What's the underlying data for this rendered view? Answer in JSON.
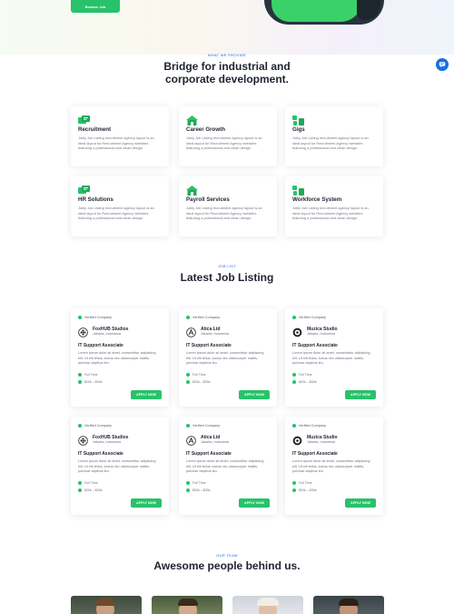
{
  "hero": {
    "button_label": "Browse Job"
  },
  "services": {
    "eyebrow": "WHAT WE PROVIDE",
    "title_line1": "Bridge for industrial and",
    "title_line2": "corporate development.",
    "items": [
      {
        "title": "Recruitment",
        "desc": "Jobly Job Listing recruitment agency layout is an ideal layout for Recruitment Agency websites featuring a professional and clean design.",
        "icon": "recruitment-icon"
      },
      {
        "title": "Career Growth",
        "desc": "Jobly Job Listing recruitment agency layout is an ideal layout for Recruitment Agency websites featuring a professional and clean design.",
        "icon": "career-growth-icon"
      },
      {
        "title": "Gigs",
        "desc": "Jobly Job Listing recruitment agency layout is an ideal layout for Recruitment Agency websites featuring a professional and clean design.",
        "icon": "gigs-icon"
      },
      {
        "title": "HR Solutions",
        "desc": "Jobly Job Listing recruitment agency layout is an ideal layout for Recruitment Agency websites featuring a professional and clean design.",
        "icon": "hr-solutions-icon"
      },
      {
        "title": "Payroll Services",
        "desc": "Jobly Job Listing recruitment agency layout is an ideal layout for Recruitment Agency websites featuring a professional and clean design.",
        "icon": "payroll-icon"
      },
      {
        "title": "Workforce System",
        "desc": "Jobly Job Listing recruitment agency layout is an ideal layout for Recruitment Agency websites featuring a professional and clean design.",
        "icon": "workforce-icon"
      }
    ]
  },
  "jobs": {
    "eyebrow": "JOB LIST",
    "title": "Latest Job Listing",
    "items": [
      {
        "verified": "Verified Company",
        "company": "FoxHUB Studios",
        "location": "Jakarta, Indonesia",
        "role": "IT Support Associate",
        "desc": "Lorem ipsum dolor sit amet, consectetur adipiscing elit. Ut elit tellus, luctus nec ullamcorper mattis, pulvinar dapibus leo.",
        "type": "Full Time",
        "salary": "$20k – $30k",
        "apply": "APPLY NOW",
        "logo": "foxhub-logo"
      },
      {
        "verified": "Verified Company",
        "company": "Atica Ltd",
        "location": "Jakarta, Indonesia",
        "role": "IT Support Associate",
        "desc": "Lorem ipsum dolor sit amet, consectetur adipiscing elit. Ut elit tellus, luctus nec ullamcorper mattis, pulvinar dapibus leo.",
        "type": "Full Time",
        "salary": "$20k – $30k",
        "apply": "APPLY NOW",
        "logo": "atica-logo"
      },
      {
        "verified": "Verified Company",
        "company": "Muzica Studio",
        "location": "Jakarta, Indonesia",
        "role": "IT Support Associate",
        "desc": "Lorem ipsum dolor sit amet, consectetur adipiscing elit. Ut elit tellus, luctus nec ullamcorper mattis, pulvinar dapibus leo.",
        "type": "Full Time",
        "salary": "$20k – $30k",
        "apply": "APPLY NOW",
        "logo": "muzica-logo"
      },
      {
        "verified": "Verified Company",
        "company": "FoxHUB Studios",
        "location": "Jakarta, Indonesia",
        "role": "IT Support Associate",
        "desc": "Lorem ipsum dolor sit amet, consectetur adipiscing elit. Ut elit tellus, luctus nec ullamcorper mattis, pulvinar dapibus leo.",
        "type": "Full Time",
        "salary": "$20k – $30k",
        "apply": "APPLY NOW",
        "logo": "foxhub-logo"
      },
      {
        "verified": "Verified Company",
        "company": "Atica Ltd",
        "location": "Jakarta, Indonesia",
        "role": "IT Support Associate",
        "desc": "Lorem ipsum dolor sit amet, consectetur adipiscing elit. Ut elit tellus, luctus nec ullamcorper mattis, pulvinar dapibus leo.",
        "type": "Full Time",
        "salary": "$20k – $30k",
        "apply": "APPLY NOW",
        "logo": "atica-logo"
      },
      {
        "verified": "Verified Company",
        "company": "Muzica Studio",
        "location": "Jakarta, Indonesia",
        "role": "IT Support Associate",
        "desc": "Lorem ipsum dolor sit amet, consectetur adipiscing elit. Ut elit tellus, luctus nec ullamcorper mattis, pulvinar dapibus leo.",
        "type": "Full Time",
        "salary": "$20k – $30k",
        "apply": "APPLY NOW",
        "logo": "muzica-logo"
      }
    ]
  },
  "team": {
    "eyebrow": "OUR TEAM",
    "title": "Awesome people behind us."
  },
  "colors": {
    "accent_green": "#27c26a",
    "eyebrow_blue": "#2563eb",
    "chat_blue": "#1a6fe0"
  }
}
